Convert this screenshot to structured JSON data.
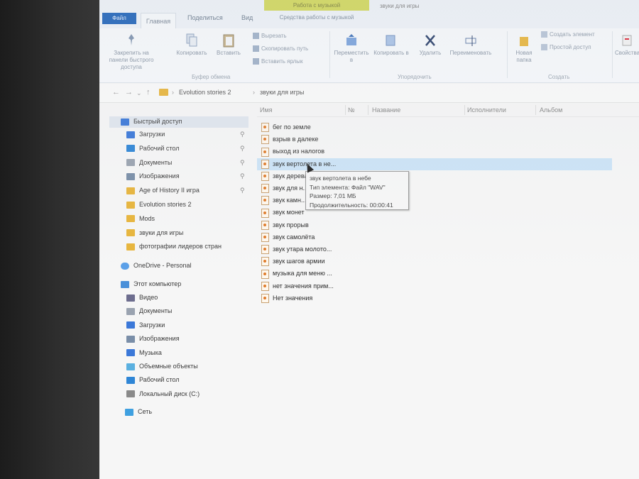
{
  "ribbon": {
    "tab_file": "Файл",
    "tab_home": "Главная",
    "tab_share": "Поделиться",
    "tab_view": "Вид",
    "context_tab_header": "Работа с музыкой",
    "context_tab": "Средства работы с музыкой",
    "window_title": "звуки для игры",
    "buttons": {
      "pin": "Закрепить на панели быстрого доступа",
      "copy": "Копировать",
      "paste": "Вставить",
      "cut": "Вырезать",
      "copy_path": "Скопировать путь",
      "paste_shortcut": "Вставить ярлык",
      "move_to": "Переместить в",
      "copy_to": "Копировать в",
      "delete": "Удалить",
      "rename": "Переименовать",
      "new_folder": "Новая папка",
      "new_item": "Создать элемент",
      "easy_access": "Простой доступ",
      "properties": "Свойства"
    },
    "groups": {
      "clipboard": "Буфер обмена",
      "organize": "Упорядочить",
      "new": "Создать"
    }
  },
  "address": {
    "crumb_root": "Evolution stories 2",
    "crumb_sep": "›",
    "crumb_current": "звуки для игры"
  },
  "sidebar": {
    "quick_access": "Быстрый доступ",
    "quick_items": [
      {
        "label": "Загрузки",
        "color": "#3b78d8"
      },
      {
        "label": "Рабочий стол",
        "color": "#2f86d6"
      },
      {
        "label": "Документы",
        "color": "#9aa3b0"
      },
      {
        "label": "Изображения",
        "color": "#7a8ea8"
      },
      {
        "label": "Age of History II игра",
        "color": "#e8b53c"
      },
      {
        "label": "Evolution stories 2",
        "color": "#e8b53c"
      },
      {
        "label": "Mods",
        "color": "#e8b53c"
      },
      {
        "label": "звуки для игры",
        "color": "#e8b53c"
      },
      {
        "label": "фотографии лидеров стран",
        "color": "#e8b53c"
      }
    ],
    "onedrive": "OneDrive - Personal",
    "this_pc": "Этот компьютер",
    "pc_items": [
      {
        "label": "Видео",
        "color": "#6d6d8e"
      },
      {
        "label": "Документы",
        "color": "#9aa3b0"
      },
      {
        "label": "Загрузки",
        "color": "#3b78d8"
      },
      {
        "label": "Изображения",
        "color": "#7a8ea8"
      },
      {
        "label": "Музыка",
        "color": "#3b78d8"
      },
      {
        "label": "Объемные объекты",
        "color": "#5ab0e0"
      },
      {
        "label": "Рабочий стол",
        "color": "#2f86d6"
      },
      {
        "label": "Локальный диск (C:)",
        "color": "#8a8a8a"
      }
    ],
    "network": "Сеть"
  },
  "columns": {
    "name": "Имя",
    "number": "№",
    "title": "Название",
    "artist": "Исполнители",
    "album": "Альбом"
  },
  "files": [
    "бег по земле",
    "взрыв в далеке",
    "выход из налогов",
    "звук вертолета в не...",
    "звук дерева...",
    "звук для н...",
    "звук камн...",
    "звук монет",
    "звук прорыв",
    "звук самолёта",
    "звук утара молото...",
    "звук шагов армии",
    "музыка для меню ...",
    "нет значения прим...",
    "Нет значения"
  ],
  "tooltip": {
    "line1": "звук вертолета в небе",
    "line2": "Тип элемента: Файл \"WAV\"",
    "line3": "Размер: 7,01 МБ",
    "line4": "Продолжительность: 00:00:41"
  }
}
